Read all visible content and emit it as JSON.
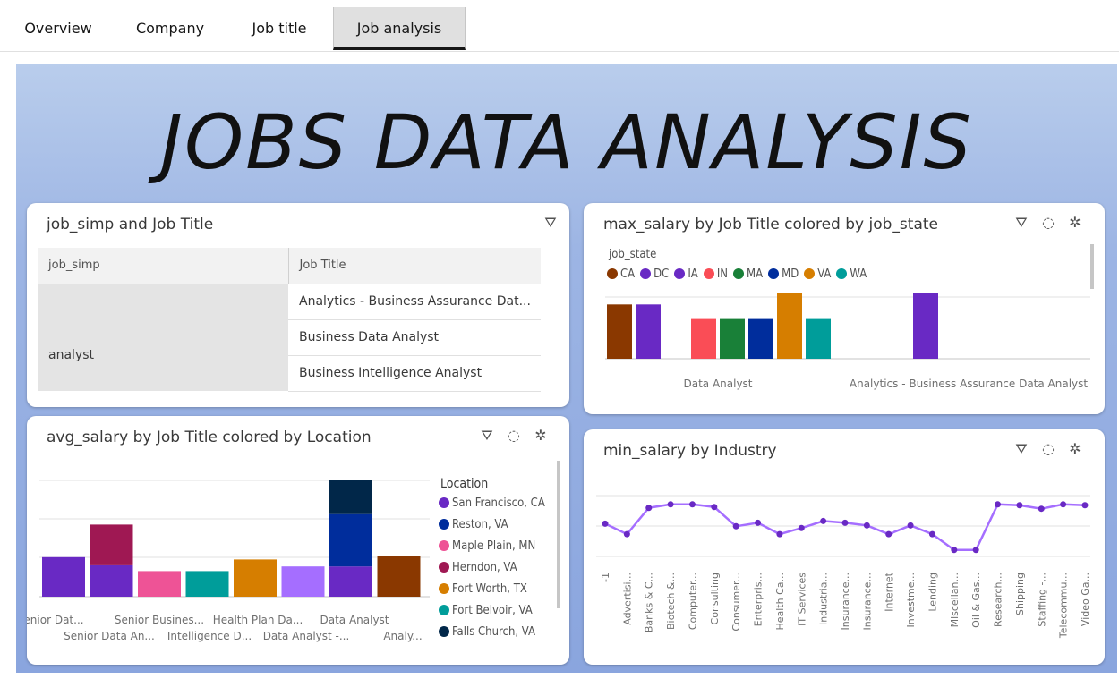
{
  "tabs": [
    {
      "label": "Overview",
      "active": false
    },
    {
      "label": "Company",
      "active": false
    },
    {
      "label": "Job title",
      "active": false
    },
    {
      "label": "Job analysis",
      "active": true
    }
  ],
  "dashboard_title": "JOBS DATA ANALYSIS",
  "table_card": {
    "title": "job_simp and Job Title",
    "columns": [
      "job_simp",
      "Job Title"
    ],
    "group": "analyst",
    "rows": [
      "Analytics - Business Assurance Dat...",
      "Business Data Analyst",
      "Business Intelligence Analyst"
    ]
  },
  "max_card": {
    "title": "max_salary by Job Title colored by job_state",
    "legend_title": "job_state",
    "legend": [
      {
        "name": "CA",
        "color": "#8a3800"
      },
      {
        "name": "DC",
        "color": "#6929c4"
      },
      {
        "name": "IA",
        "color": "#6929c4"
      },
      {
        "name": "IN",
        "color": "#fa4d56"
      },
      {
        "name": "MA",
        "color": "#198038"
      },
      {
        "name": "MD",
        "color": "#002d9c"
      },
      {
        "name": "VA",
        "color": "#d67e00"
      },
      {
        "name": "WA",
        "color": "#009d9a"
      }
    ]
  },
  "avg_card": {
    "title": "avg_salary by Job Title colored by Location",
    "legend_title": "Location",
    "legend": [
      {
        "name": "San Francisco, CA",
        "color": "#6929c4"
      },
      {
        "name": "Reston, VA",
        "color": "#002d9c"
      },
      {
        "name": "Maple Plain, MN",
        "color": "#ee5396"
      },
      {
        "name": "Herndon, VA",
        "color": "#9f1853"
      },
      {
        "name": "Fort Worth, TX",
        "color": "#d67e00"
      },
      {
        "name": "Fort Belvoir, VA",
        "color": "#009d9a"
      },
      {
        "name": "Falls Church, VA",
        "color": "#012749"
      }
    ]
  },
  "min_card": {
    "title": "min_salary by Industry"
  },
  "chart_data": [
    {
      "type": "bar",
      "title": "max_salary by Job Title colored by job_state",
      "categories": [
        "Data Analyst",
        "Analytics - Business Assurance Data Analyst"
      ],
      "series": [
        {
          "name": "CA",
          "color": "#8a3800",
          "values": [
            0.82,
            null
          ]
        },
        {
          "name": "DC",
          "color": "#6929c4",
          "values": [
            0.82,
            null
          ]
        },
        {
          "name": "IN",
          "color": "#fa4d56",
          "values": [
            0.6,
            null
          ]
        },
        {
          "name": "MA",
          "color": "#198038",
          "values": [
            0.6,
            null
          ]
        },
        {
          "name": "MD",
          "color": "#002d9c",
          "values": [
            0.6,
            null
          ]
        },
        {
          "name": "VA",
          "color": "#d67e00",
          "values": [
            1.0,
            null
          ]
        },
        {
          "name": "WA",
          "color": "#009d9a",
          "values": [
            0.6,
            null
          ]
        },
        {
          "name": "IA",
          "color": "#6929c4",
          "values": [
            null,
            1.0
          ]
        }
      ]
    },
    {
      "type": "bar",
      "title": "avg_salary by Job Title colored by Location",
      "categories_visible_top": [
        "enior Dat...",
        "Senior Busines...",
        "Health Plan Da...",
        "Data Analyst"
      ],
      "categories_visible_bottom": [
        "Senior Data An...",
        "Intelligence D...",
        "Data Analyst -...",
        "Analy..."
      ],
      "stacks": [
        [
          {
            "loc": "San Francisco, CA",
            "color": "#6929c4",
            "value": 0.34
          }
        ],
        [
          {
            "loc": "San Francisco, CA",
            "color": "#6929c4",
            "value": 0.27
          },
          {
            "loc": "Herndon, VA",
            "color": "#9f1853",
            "value": 0.35
          }
        ],
        [
          {
            "loc": "Maple Plain, MN",
            "color": "#ee5396",
            "value": 0.22
          }
        ],
        [
          {
            "loc": "Fort Belvoir, VA",
            "color": "#009d9a",
            "value": 0.22
          }
        ],
        [
          {
            "loc": "Fort Worth, TX",
            "color": "#d67e00",
            "value": 0.32
          }
        ],
        [
          {
            "loc": "San Francisco, CA",
            "color": "#a56eff",
            "value": 0.26
          }
        ],
        [
          {
            "loc": "San Francisco, CA",
            "color": "#6929c4",
            "value": 0.26
          },
          {
            "loc": "Reston, VA",
            "color": "#002d9c",
            "value": 0.45
          },
          {
            "loc": "Falls Church, VA",
            "color": "#012749",
            "value": 0.29
          }
        ],
        [
          {
            "loc": "",
            "color": "#8a3800",
            "value": 0.35
          }
        ]
      ]
    },
    {
      "type": "line",
      "title": "min_salary by Industry",
      "x": [
        "-1",
        "Advertisi...",
        "Banks & C...",
        "Biotech &...",
        "Computer...",
        "Consulting",
        "Consumer...",
        "Enterpris...",
        "Health Ca...",
        "IT Services",
        "Industria...",
        "Insurance...",
        "Insurance...",
        "Internet",
        "Investme...",
        "Lending",
        "Miscellan...",
        "Oil & Gas...",
        "Research...",
        "Shipping",
        "Staffing -...",
        "Telecommu...",
        "Video Ga..."
      ],
      "values": [
        0.68,
        0.56,
        0.86,
        0.9,
        0.9,
        0.87,
        0.65,
        0.69,
        0.56,
        0.63,
        0.71,
        0.69,
        0.66,
        0.56,
        0.66,
        0.56,
        0.38,
        0.38,
        0.9,
        0.89,
        0.85,
        0.9,
        0.89
      ],
      "color": "#6929c4",
      "color_light": "#a56eff"
    }
  ]
}
